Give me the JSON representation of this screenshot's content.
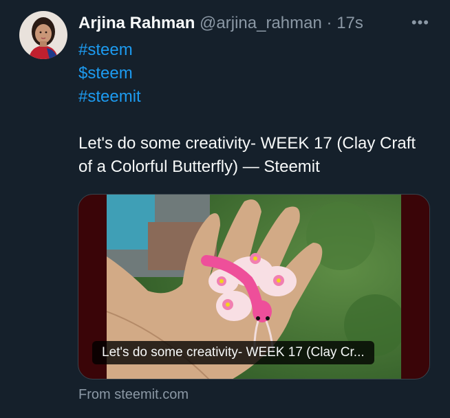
{
  "tweet": {
    "author_name": "Arjina Rahman",
    "handle": "@arjina_rahman",
    "separator": "·",
    "time": "17s",
    "more_label": "•••",
    "hashtags": [
      "#steem",
      "$steem",
      "#steemit"
    ],
    "text": "Let's do some creativity- WEEK 17 (Clay Craft of a Colorful Butterfly) — Steemit"
  },
  "card": {
    "caption": "Let's do some creativity- WEEK 17 (Clay Cr...",
    "source": "From steemit.com"
  },
  "colors": {
    "background": "#15202b",
    "link": "#1d9bf0",
    "muted": "#8b98a5",
    "text": "#f7f9f9",
    "card_backdrop": "#3a0508"
  },
  "icons": {
    "more": "more-horizontal-icon"
  }
}
